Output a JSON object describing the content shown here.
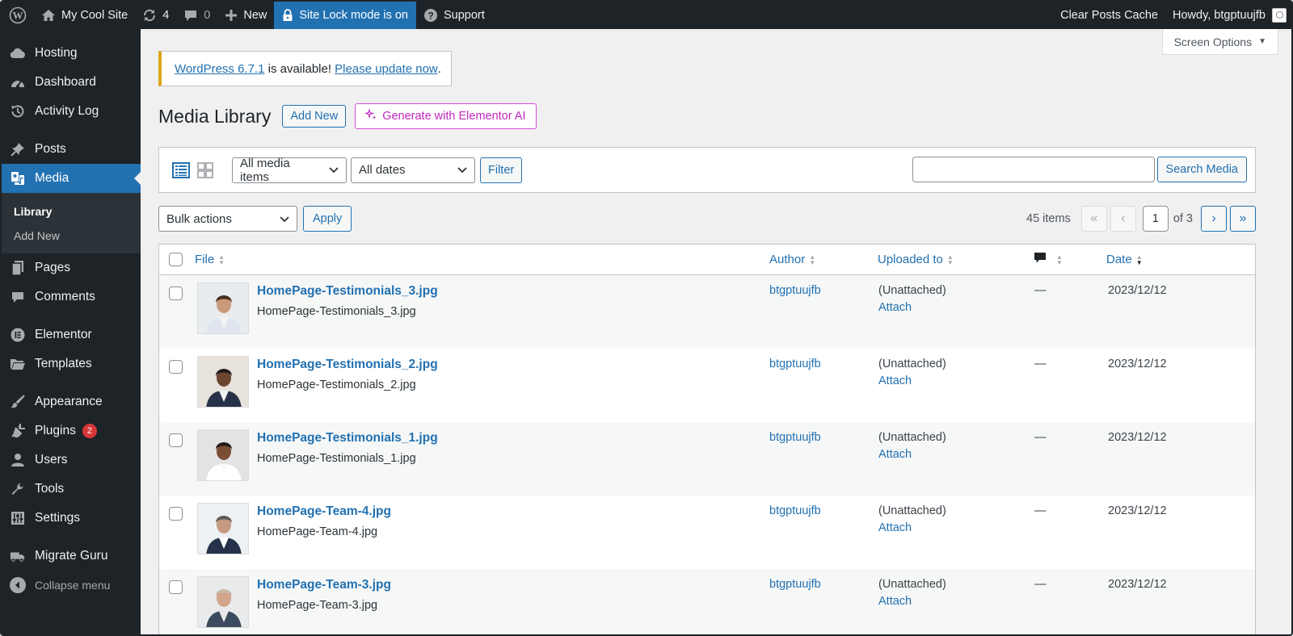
{
  "adminbar": {
    "site_name": "My Cool Site",
    "updates_count": "4",
    "comments_count": "0",
    "new_label": "New",
    "site_lock_label": "Site Lock mode is on",
    "support_label": "Support",
    "clear_cache_label": "Clear Posts Cache",
    "howdy_label": "Howdy, btgptuujfb"
  },
  "sidebar": {
    "hosting": "Hosting",
    "dashboard": "Dashboard",
    "activity_log": "Activity Log",
    "posts": "Posts",
    "media": "Media",
    "library": "Library",
    "add_new": "Add New",
    "pages": "Pages",
    "comments": "Comments",
    "elementor": "Elementor",
    "templates": "Templates",
    "appearance": "Appearance",
    "plugins": "Plugins",
    "plugins_badge": "2",
    "users": "Users",
    "tools": "Tools",
    "settings": "Settings",
    "migrate_guru": "Migrate Guru",
    "collapse": "Collapse menu"
  },
  "screen_options": "Screen Options",
  "notice": {
    "version_link": "WordPress 6.7.1",
    "middle_text": " is available! ",
    "update_link": "Please update now",
    "end": "."
  },
  "page": {
    "title": "Media Library",
    "add_new": "Add New",
    "generate_ai": "Generate with Elementor AI"
  },
  "filters": {
    "media_type": "All media items",
    "dates": "All dates",
    "filter_btn": "Filter",
    "search_value": "",
    "search_btn": "Search Media"
  },
  "bulk": {
    "actions": "Bulk actions",
    "apply": "Apply",
    "items_count": "45 items",
    "first": "«",
    "prev": "‹",
    "current_page": "1",
    "of_pages": "of 3",
    "next": "›",
    "last": "»"
  },
  "table": {
    "columns": {
      "file": "File",
      "author": "Author",
      "uploaded_to": "Uploaded to",
      "date": "Date"
    },
    "rows": [
      {
        "title": "HomePage-Testimonials_3.jpg",
        "filename": "HomePage-Testimonials_3.jpg",
        "author": "btgptuujfb",
        "uploaded_to": "(Unattached)",
        "attach": "Attach",
        "comments": "—",
        "date": "2023/12/12"
      },
      {
        "title": "HomePage-Testimonials_2.jpg",
        "filename": "HomePage-Testimonials_2.jpg",
        "author": "btgptuujfb",
        "uploaded_to": "(Unattached)",
        "attach": "Attach",
        "comments": "—",
        "date": "2023/12/12"
      },
      {
        "title": "HomePage-Testimonials_1.jpg",
        "filename": "HomePage-Testimonials_1.jpg",
        "author": "btgptuujfb",
        "uploaded_to": "(Unattached)",
        "attach": "Attach",
        "comments": "—",
        "date": "2023/12/12"
      },
      {
        "title": "HomePage-Team-4.jpg",
        "filename": "HomePage-Team-4.jpg",
        "author": "btgptuujfb",
        "uploaded_to": "(Unattached)",
        "attach": "Attach",
        "comments": "—",
        "date": "2023/12/12"
      },
      {
        "title": "HomePage-Team-3.jpg",
        "filename": "HomePage-Team-3.jpg",
        "author": "btgptuujfb",
        "uploaded_to": "(Unattached)",
        "attach": "Attach",
        "comments": "—",
        "date": "2023/12/12"
      }
    ]
  },
  "colors": {
    "admin_dark": "#1d2327",
    "accent_blue": "#2271b1",
    "notice_warning": "#dba617",
    "elementor_pink": "#c028bd",
    "badge_red": "#d63638"
  }
}
